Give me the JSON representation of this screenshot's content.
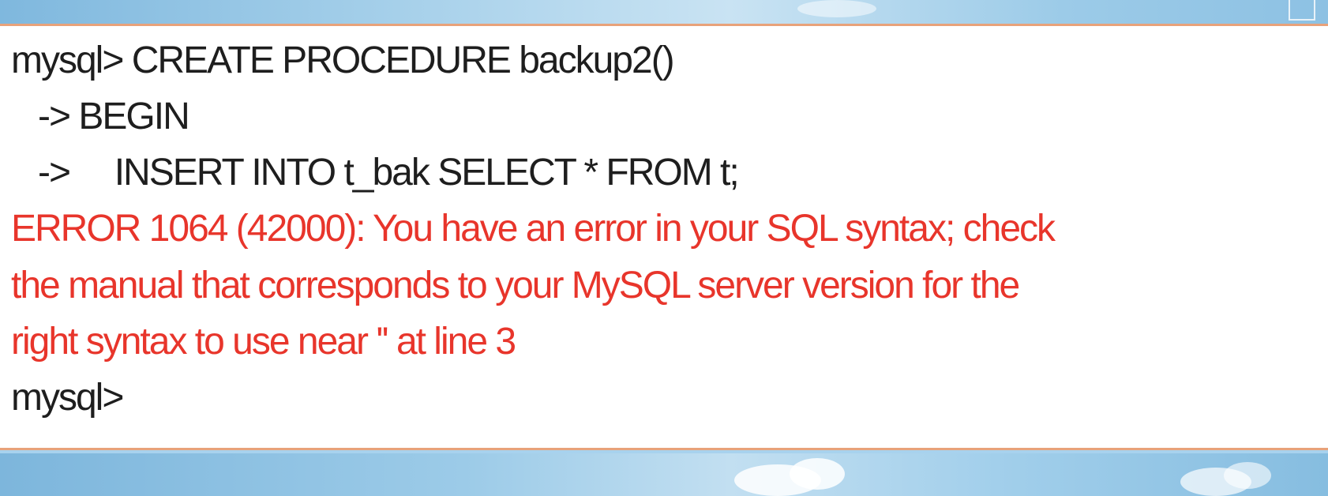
{
  "terminal": {
    "lines": [
      {
        "text": "mysql> CREATE PROCEDURE backup2()",
        "kind": "command"
      },
      {
        "text": "   -> BEGIN",
        "kind": "command"
      },
      {
        "text": "   ->     INSERT INTO t_bak SELECT * FROM t;",
        "kind": "command"
      },
      {
        "text": "ERROR 1064 (42000): You have an error in your SQL syntax; check",
        "kind": "error"
      },
      {
        "text": "the manual that corresponds to your MySQL server version for the",
        "kind": "error"
      },
      {
        "text": "right syntax to use near '' at line 3",
        "kind": "error"
      },
      {
        "text": "mysql>",
        "kind": "prompt"
      }
    ],
    "colors": {
      "text": "#1e1e1e",
      "error": "#e8352b",
      "border": "#e8a27a",
      "background": "#ffffff"
    }
  }
}
